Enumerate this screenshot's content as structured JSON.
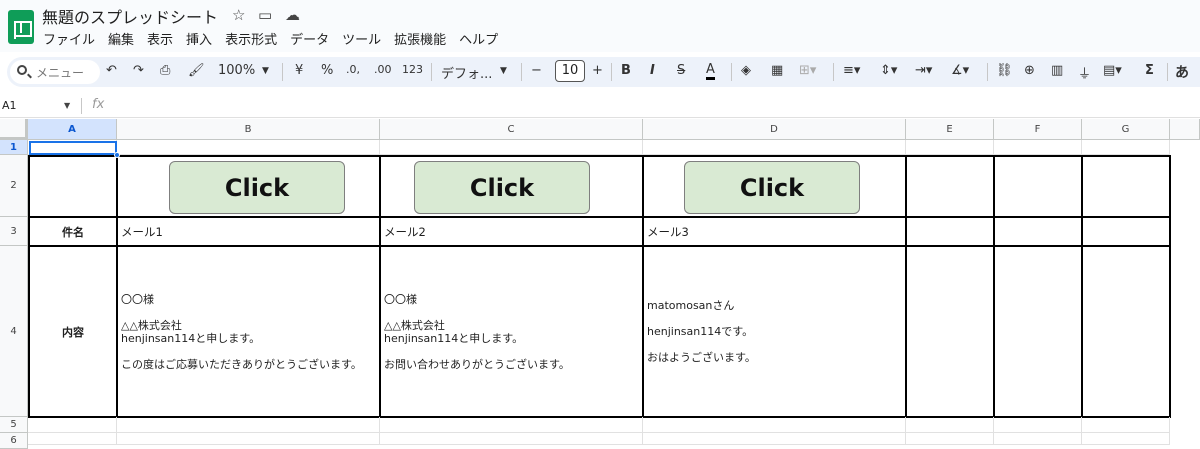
{
  "doc": {
    "title": "無題のスプレッドシート"
  },
  "menu": [
    "ファイル",
    "編集",
    "表示",
    "挿入",
    "表示形式",
    "データ",
    "ツール",
    "拡張機能",
    "ヘルプ"
  ],
  "toolbar": {
    "search_placeholder": "メニュー",
    "zoom": "100%",
    "currency": "¥",
    "percent": "%",
    "dec_minus": ".0,",
    "dec_plus": ".00",
    "num_format": "123",
    "font": "デフォ...",
    "font_size": "10",
    "minus": "−",
    "plus": "+",
    "bold": "B",
    "italic": "I",
    "strike": "S",
    "text_color": "A",
    "input_method": "あ"
  },
  "formula_bar": {
    "name_box": "A1",
    "fx": "fx"
  },
  "columns": [
    "A",
    "B",
    "C",
    "D",
    "E",
    "F",
    "G"
  ],
  "rows": [
    "1",
    "2",
    "3",
    "4",
    "5",
    "6"
  ],
  "sheet": {
    "buttons": [
      "Click",
      "Click",
      "Click"
    ],
    "subject_label": "件名",
    "body_label": "内容",
    "subjects": [
      "メール1",
      "メール2",
      "メール3"
    ],
    "bodies": [
      "〇〇様\n\n△△株式会社\nhenjinsan114と申します。\n\nこの度はご応募いただきありがとうございます。",
      "〇〇様\n\n△△株式会社\nhenjinsan114と申します。\n\nお問い合わせありがとうございます。",
      "matomosanさん\n\nhenjinsan114です。\n\nおはようございます。"
    ]
  },
  "colors": {
    "button_fill": "#d9ead3",
    "selection": "#1a73e8",
    "brand": "#0f9d58"
  }
}
